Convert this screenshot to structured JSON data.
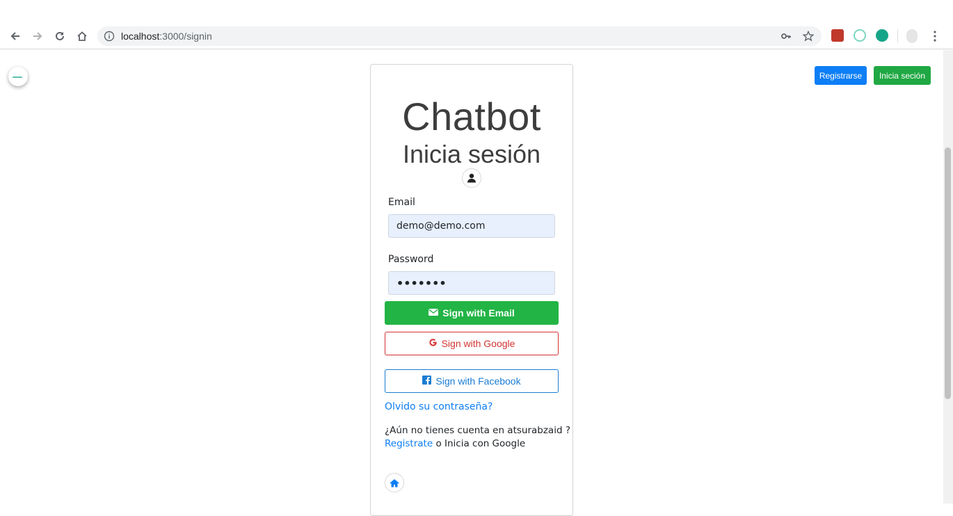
{
  "browser": {
    "url_host": "localhost",
    "url_path": ":3000/signin"
  },
  "header": {
    "register_label": "Registrarse",
    "login_label": "Inicia seción"
  },
  "card": {
    "title": "Chatbot",
    "subtitle": "Inicia sesión",
    "email_label": "Email",
    "email_value": "demo@demo.com",
    "password_label": "Password",
    "password_value": "•••••••",
    "email_button": "Sign with Email",
    "google_button": "Sign with Google",
    "facebook_button": "Sign with Facebook",
    "forgot_link": "Olvido su contraseña?",
    "no_account_text": "¿Aún no tienes cuenta en atsurabzaid ?",
    "register_link": "Registrate",
    "or_text": " o Inicia con Google"
  },
  "colors": {
    "primary": "#0d7ef5",
    "success": "#22b445",
    "google": "#d33232",
    "facebook": "#1a7cd3"
  },
  "icons": [
    "back-icon",
    "forward-icon",
    "reload-icon",
    "home-icon",
    "info-icon",
    "key-icon",
    "star-icon",
    "user-icon",
    "envelope-icon",
    "google-icon",
    "facebook-icon",
    "house-icon",
    "menu-icon"
  ]
}
